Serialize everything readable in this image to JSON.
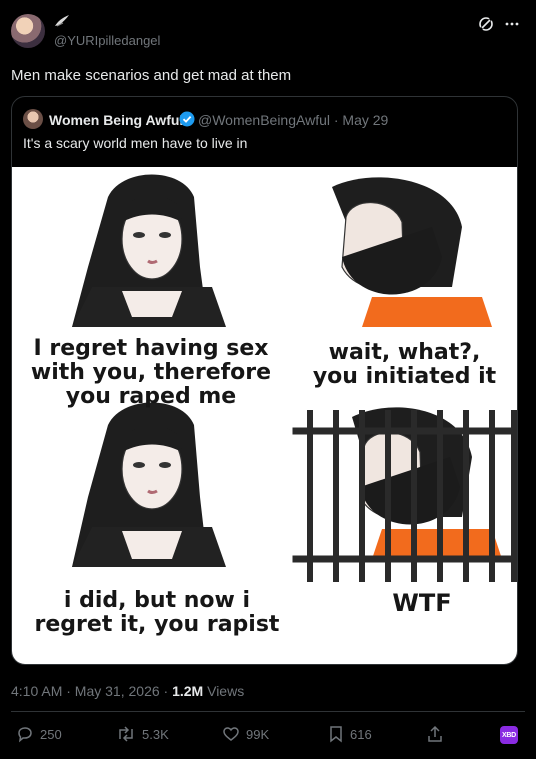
{
  "post": {
    "handle": "@YURIpilledangel",
    "text": "Men make scenarios and get mad at them"
  },
  "quote": {
    "name": "Women Being Awful",
    "meta": "@WomenBeingAwful · May 29",
    "text": "It's a scary world men have to live in",
    "meme": {
      "panel1": [
        "I regret having sex",
        "with you, therefore",
        "you raped me"
      ],
      "panel2": [
        "wait, what?,",
        "you initiated it"
      ],
      "panel3": [
        "i did, but now i",
        "regret it, you rapist"
      ],
      "panel4": "WTF"
    }
  },
  "timestamp": {
    "time": "4:10 AM · May 31, 2026 · ",
    "views": "1.2M",
    "views_label": " Views"
  },
  "actions": {
    "replies": "250",
    "reposts": "5.3K",
    "likes": "99K",
    "bookmarks": "616",
    "badge": "XBD"
  },
  "colors": {
    "background": "#000000",
    "text": "#e7e9ea",
    "muted": "#71767b",
    "border": "#2f3336",
    "verified": "#1d9bf0",
    "badge": "#8a2be2",
    "jumpsuit": "#f26b1d"
  },
  "icons": [
    "grok-icon",
    "more-icon",
    "reply-icon",
    "repost-icon",
    "like-icon",
    "bookmark-icon",
    "share-icon",
    "verified-icon"
  ]
}
